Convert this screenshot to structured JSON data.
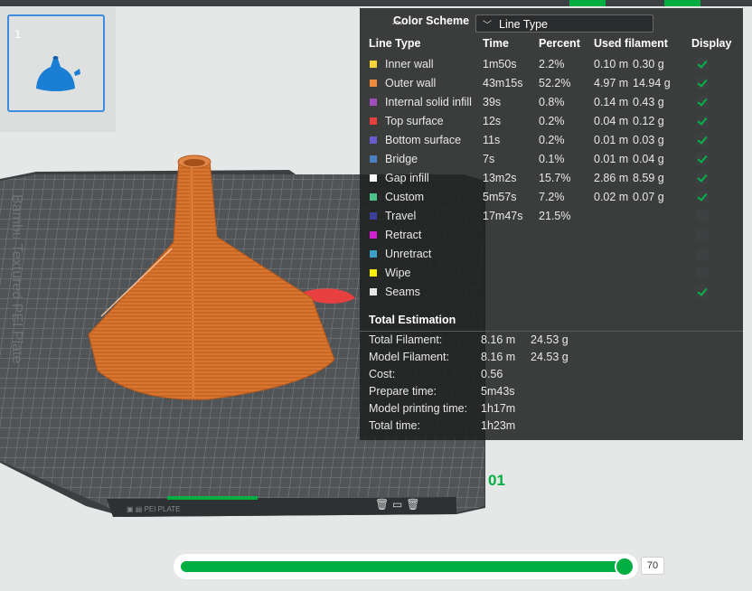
{
  "thumbnail": {
    "plate_number": "1"
  },
  "plate": {
    "brand_text": "Bambu Textured PEI Plate",
    "plate_label": "01"
  },
  "panel": {
    "title": "Color Scheme",
    "scheme_select": "Line Type",
    "columns": [
      "Line Type",
      "Time",
      "Percent",
      "Used filament",
      "Display"
    ],
    "rows": [
      {
        "label": "Inner wall",
        "color": "#f5d33a",
        "time": "1m50s",
        "percent": "2.2%",
        "length": "0.10 m",
        "weight": "0.30 g",
        "display": true
      },
      {
        "label": "Outer wall",
        "color": "#f08a3c",
        "time": "43m15s",
        "percent": "52.2%",
        "length": "4.97 m",
        "weight": "14.94 g",
        "display": true
      },
      {
        "label": "Internal solid infill",
        "color": "#a04ec0",
        "time": "39s",
        "percent": "0.8%",
        "length": "0.14 m",
        "weight": "0.43 g",
        "display": true
      },
      {
        "label": "Top surface",
        "color": "#e84040",
        "time": "12s",
        "percent": "0.2%",
        "length": "0.04 m",
        "weight": "0.12 g",
        "display": true
      },
      {
        "label": "Bottom surface",
        "color": "#6a5acd",
        "time": "11s",
        "percent": "0.2%",
        "length": "0.01 m",
        "weight": "0.03 g",
        "display": true
      },
      {
        "label": "Bridge",
        "color": "#4a80c0",
        "time": "7s",
        "percent": "0.1%",
        "length": "0.01 m",
        "weight": "0.04 g",
        "display": true
      },
      {
        "label": "Gap infill",
        "color": "#ffffff",
        "time": "13m2s",
        "percent": "15.7%",
        "length": "2.86 m",
        "weight": "8.59 g",
        "display": true
      },
      {
        "label": "Custom",
        "color": "#4fc08a",
        "time": "5m57s",
        "percent": "7.2%",
        "length": "0.02 m",
        "weight": "0.07 g",
        "display": true
      },
      {
        "label": "Travel",
        "color": "#3a3f9a",
        "time": "17m47s",
        "percent": "21.5%",
        "length": "",
        "weight": "",
        "display": false
      },
      {
        "label": "Retract",
        "color": "#d020d0",
        "time": "",
        "percent": "",
        "length": "",
        "weight": "",
        "display": false
      },
      {
        "label": "Unretract",
        "color": "#3aa0c8",
        "time": "",
        "percent": "",
        "length": "",
        "weight": "",
        "display": false
      },
      {
        "label": "Wipe",
        "color": "#ffee00",
        "time": "",
        "percent": "",
        "length": "",
        "weight": "",
        "display": false
      },
      {
        "label": "Seams",
        "color": "#e6e6e6",
        "time": "",
        "percent": "",
        "length": "",
        "weight": "",
        "display": true
      }
    ],
    "total_title": "Total Estimation",
    "totals": [
      {
        "label": "Total Filament:",
        "v1": "8.16 m",
        "v2": "24.53 g"
      },
      {
        "label": "Model Filament:",
        "v1": "8.16 m",
        "v2": "24.53 g"
      },
      {
        "label": "Cost:",
        "v1": "0.56",
        "v2": ""
      },
      {
        "label": "Prepare time:",
        "v1": "5m43s",
        "v2": ""
      },
      {
        "label": "Model printing time:",
        "v1": "1h17m",
        "v2": ""
      },
      {
        "label": "Total time:",
        "v1": "1h23m",
        "v2": ""
      }
    ]
  },
  "slider": {
    "value": "70",
    "fraction": 0.985
  },
  "colors": {
    "accent": "#00ae42",
    "model": "#d9752e"
  }
}
